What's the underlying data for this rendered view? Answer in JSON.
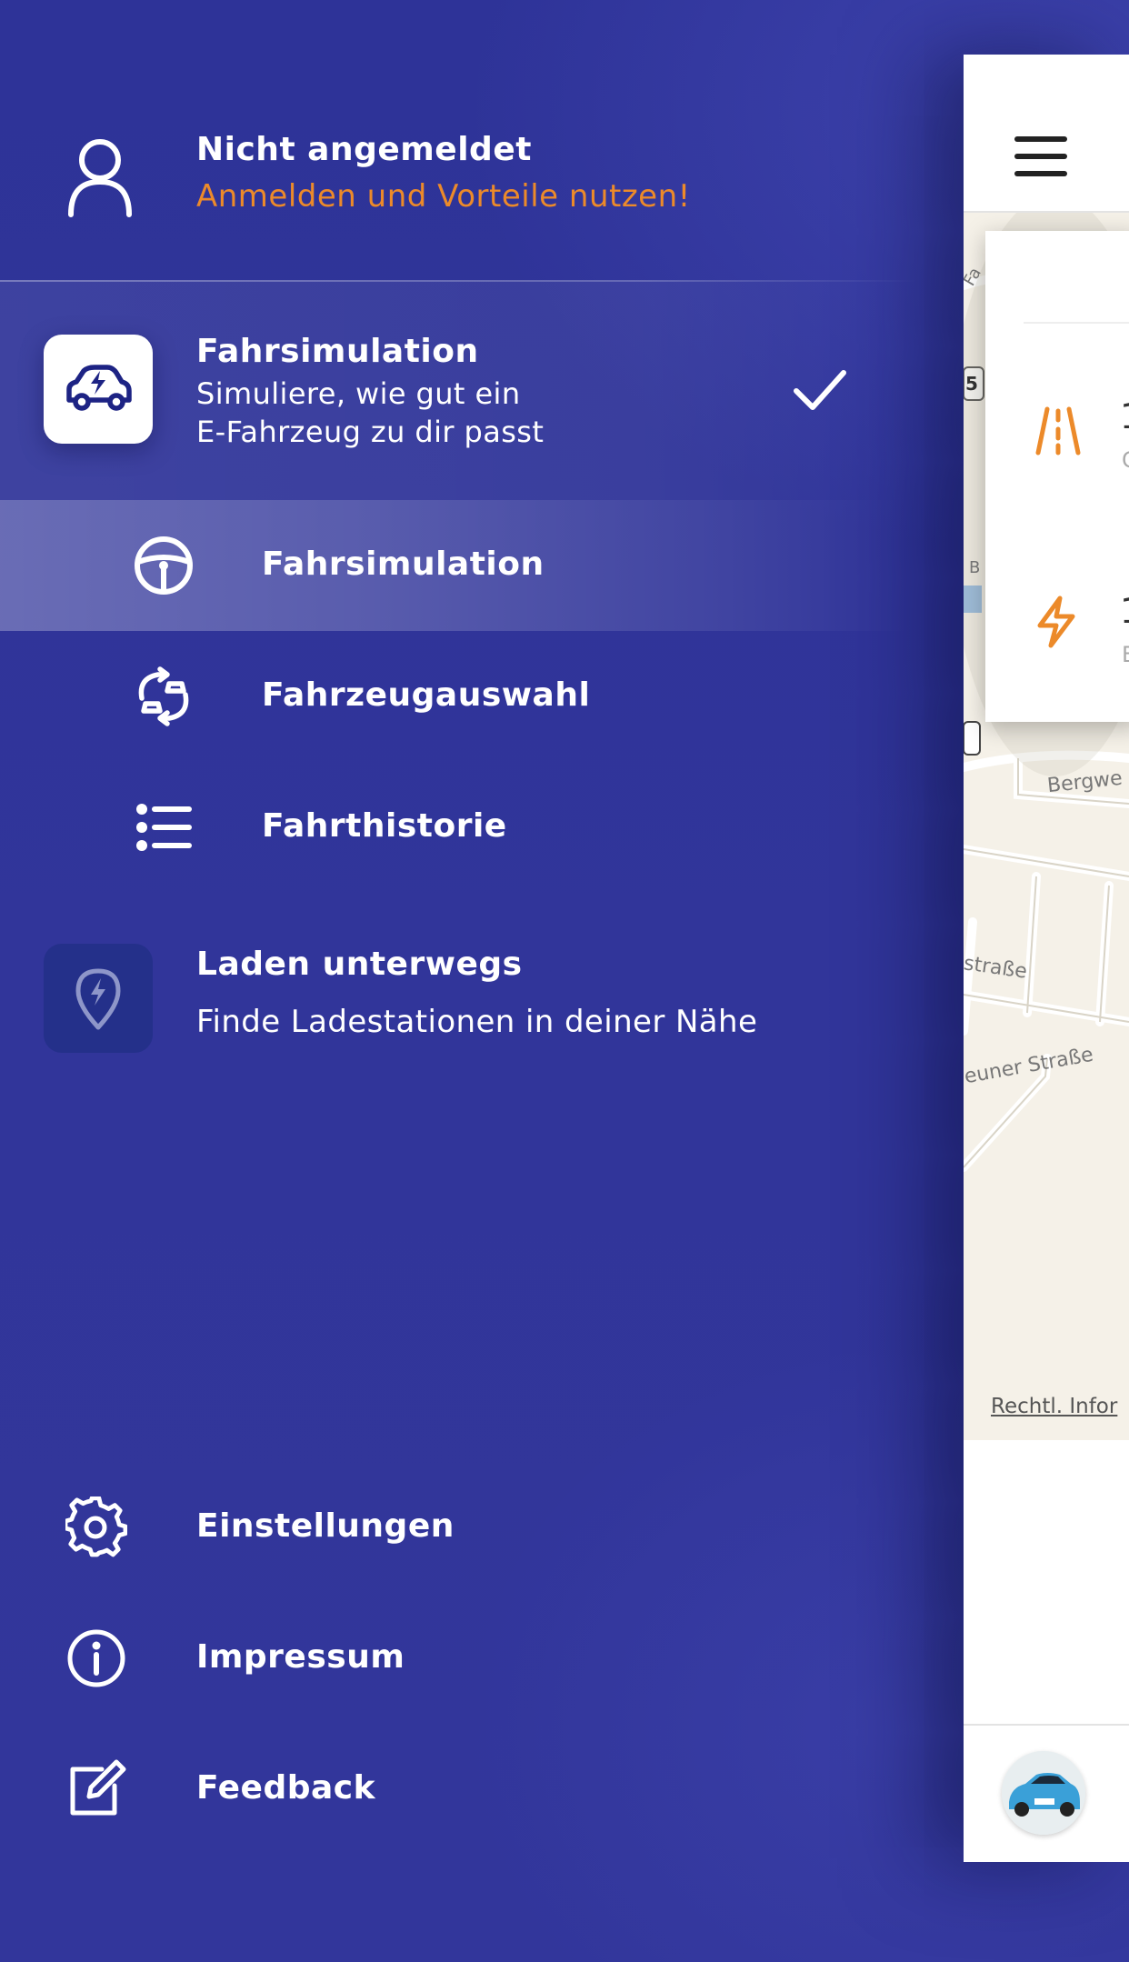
{
  "user": {
    "status": "Nicht angemeldet",
    "cta": "Anmelden und Vorteile nutzen!",
    "icon": "user-icon"
  },
  "section_simulation": {
    "title": "Fahrsimulation",
    "description_line1": "Simuliere, wie gut ein",
    "description_line2": "E-Fahrzeug zu dir passt",
    "icon": "electric-car-icon",
    "selected": true
  },
  "sub_items": [
    {
      "label": "Fahrsimulation",
      "icon": "steering-wheel-icon",
      "active": true
    },
    {
      "label": "Fahrzeugauswahl",
      "icon": "car-swap-icon",
      "active": false
    },
    {
      "label": "Fahrthistorie",
      "icon": "list-icon",
      "active": false
    }
  ],
  "section_charging": {
    "title": "Laden unterwegs",
    "description": "Finde Ladestationen in deiner Nähe",
    "icon": "charging-pin-icon"
  },
  "bottom_items": [
    {
      "label": "Einstellungen",
      "icon": "gear-icon"
    },
    {
      "label": "Impressum",
      "icon": "info-icon"
    },
    {
      "label": "Feedback",
      "icon": "edit-icon"
    }
  ],
  "peek": {
    "map_labels": [
      "straße",
      "euner Straße",
      "Bergwe",
      "5",
      "Fa",
      "B"
    ],
    "card_digits": [
      "1",
      "1"
    ],
    "card_subs": [
      "C",
      "E"
    ],
    "legal_link": "Rechtl. Infor"
  },
  "colors": {
    "drawer_bg": "#31359a",
    "accent_orange": "#ec8a2a",
    "tile_dark": "#24308a",
    "icon_navy": "#1d2384"
  }
}
